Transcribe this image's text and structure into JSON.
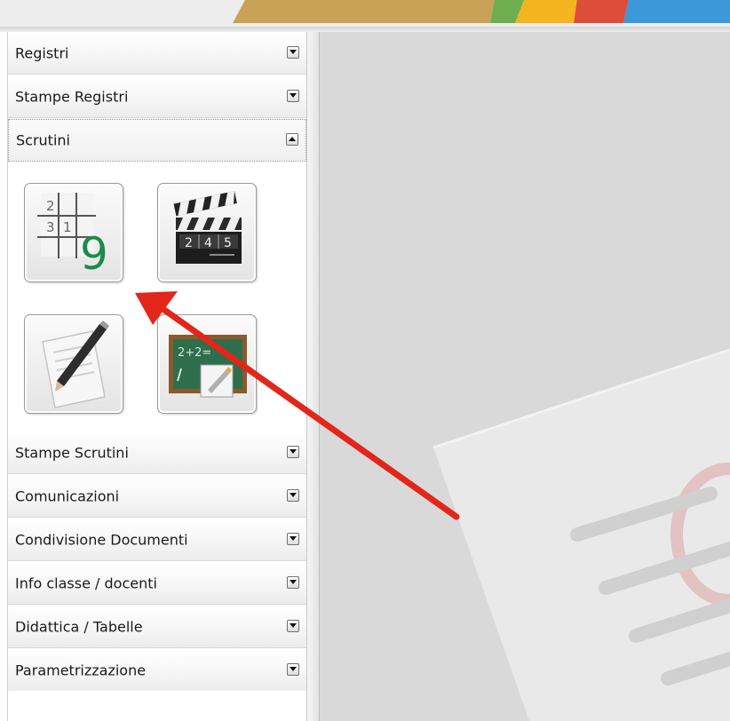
{
  "sidebar": {
    "sections": [
      {
        "label": "Registri",
        "state": "collapsed"
      },
      {
        "label": "Stampe Registri",
        "state": "collapsed"
      },
      {
        "label": "Scrutini",
        "state": "expanded"
      },
      {
        "label": "Stampe Scrutini",
        "state": "collapsed"
      },
      {
        "label": "Comunicazioni",
        "state": "collapsed"
      },
      {
        "label": "Condivisione Documenti",
        "state": "collapsed"
      },
      {
        "label": "Info classe / docenti",
        "state": "collapsed"
      },
      {
        "label": "Didattica / Tabelle",
        "state": "collapsed"
      },
      {
        "label": "Parametrizzazione",
        "state": "collapsed"
      }
    ]
  },
  "scrutini_tiles": [
    {
      "icon": "grade-grid-icon",
      "grid_digits": [
        "2",
        "3",
        "1"
      ],
      "big_digit": "9"
    },
    {
      "icon": "clapperboard-icon",
      "digits": [
        "2",
        "4",
        "5"
      ]
    },
    {
      "icon": "document-pencil-icon"
    },
    {
      "icon": "chalkboard-icon",
      "chalk_text": "2+2="
    }
  ],
  "colors": {
    "annotation_arrow": "#e2261a",
    "content_background": "#d9d9da",
    "grade_digit": "#1e8a4c"
  }
}
